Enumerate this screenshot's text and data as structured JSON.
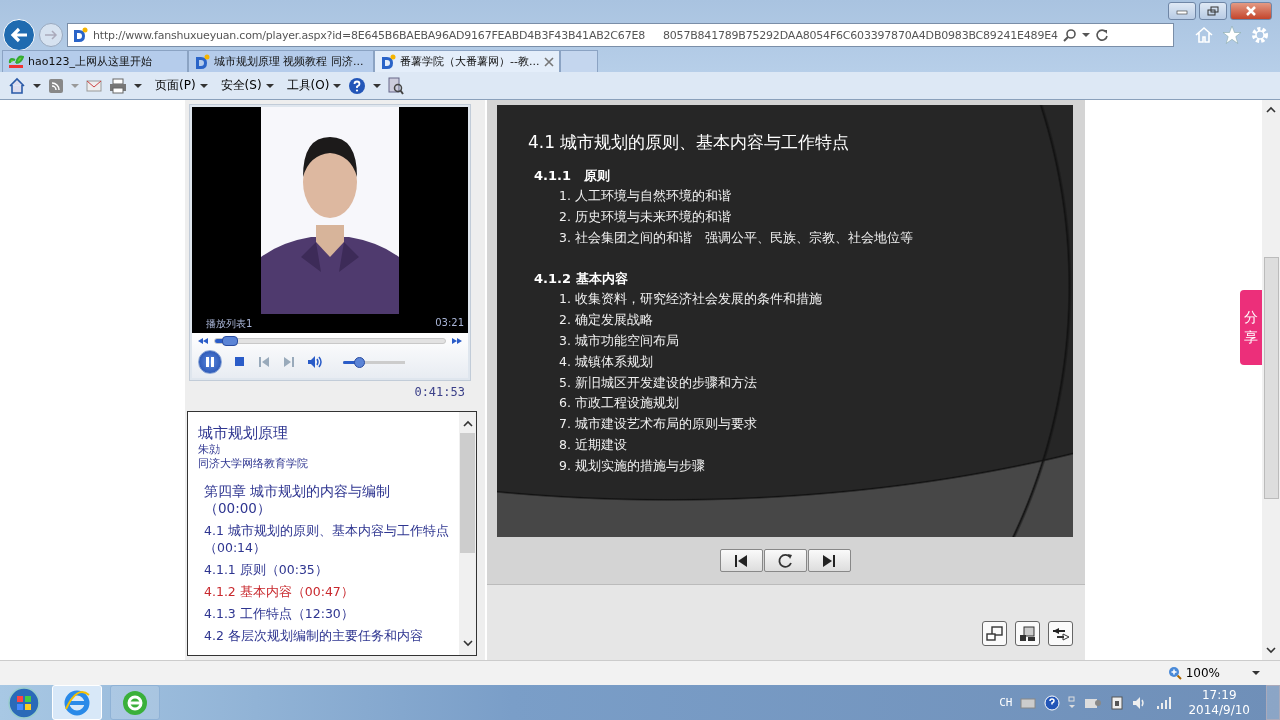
{
  "address_bar": {
    "url_start": "http://www.fanshuxueyuan.com/player.aspx?id=8E645B6BAEBA96AD9167FEABD4B3F43B41AB2C67E8",
    "url_end": "8057B841789B75292DAA8054F6C603397870A4DB0983BC89241E489E4"
  },
  "tabs": [
    {
      "label": "hao123_上网从这里开始",
      "kind": "hao",
      "selected": false
    },
    {
      "label": "城市规划原理 视频教程 同济...",
      "kind": "site",
      "selected": false
    },
    {
      "label": "番薯学院（大番薯网）--教...",
      "kind": "site",
      "selected": true
    }
  ],
  "command_bar": [
    "页面(P)",
    "安全(S)",
    "工具(O)"
  ],
  "player": {
    "playlist_label": "播放列表1",
    "duration": "03:21",
    "progress": {
      "level": 0.06
    },
    "volume": {
      "level": 0.25
    },
    "playing": true,
    "elapsed": "0:41:53"
  },
  "outline": {
    "course_title": "城市规划原理",
    "teacher": "朱勍",
    "school": "同济大学网络教育学院",
    "items": [
      {
        "text": "第四章  城市规划的内容与编制（00:00）",
        "kind": "chapter",
        "selected": false
      },
      {
        "text": "4.1 城市规划的原则、基本内容与工作特点（00:14）",
        "kind": "section",
        "selected": false
      },
      {
        "text": "4.1.1 原则（00:35）",
        "kind": "section",
        "selected": false
      },
      {
        "text": "4.1.2 基本内容（00:47）",
        "kind": "section",
        "selected": true
      },
      {
        "text": "4.1.3 工作特点（12:30）",
        "kind": "section",
        "selected": false
      },
      {
        "text": "4.2 各层次规划编制的主要任务和内容",
        "kind": "section",
        "selected": false
      }
    ]
  },
  "slide": {
    "title": "4.1  城市规划的原则、基本内容与工作特点",
    "sections": [
      {
        "heading": "4.1.1　原则",
        "items": [
          "1. 人工环境与自然环境的和谐",
          "2. 历史环境与未来环境的和谐",
          "3. 社会集团之间的和谐　强调公平、民族、宗教、社会地位等"
        ]
      },
      {
        "heading": "4.1.2 基本内容",
        "items": [
          "1. 收集资料，研究经济社会发展的条件和措施",
          "2. 确定发展战略",
          "3. 城市功能空间布局",
          "4. 城镇体系规划",
          "5. 新旧城区开发建设的步骤和方法",
          "6. 市政工程设施规划",
          "7. 城市建设艺术布局的原则与要求",
          "8. 近期建设",
          "9. 规划实施的措施与步骤"
        ]
      }
    ]
  },
  "share_tab": {
    "label": "分享"
  },
  "status_bar": {
    "zoom": "100%"
  },
  "taskbar": {
    "apps": [
      {
        "kind": "browser",
        "selected": true
      },
      {
        "kind": "green-browser",
        "selected": false
      }
    ],
    "language": "CH",
    "time": "17:19",
    "date": "2014/9/10"
  }
}
